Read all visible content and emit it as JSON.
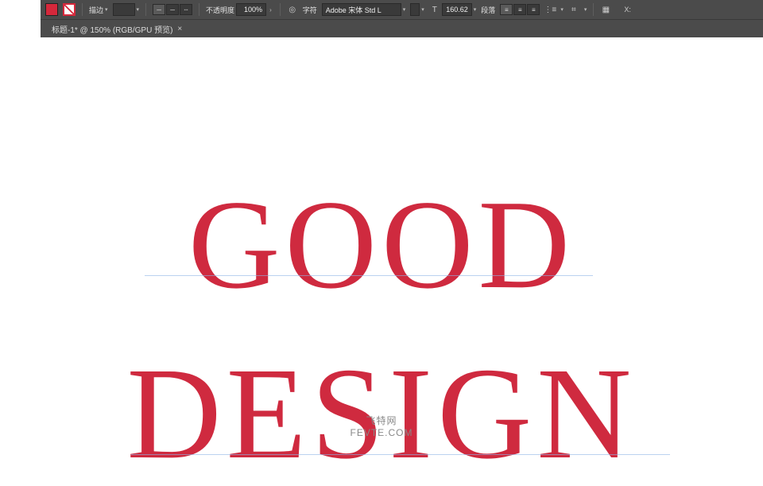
{
  "toolbar": {
    "brush_label": "描边",
    "thickness_dd": "",
    "opacity_label": "不透明度",
    "opacity_value": "100%",
    "char_label": "字符",
    "font_family": "Adobe 宋体 Std L",
    "font_size_value": "160.62",
    "paragraph_label": "段落"
  },
  "tab": {
    "label": "标题-1* @ 150% (RGB/GPU 预览)",
    "close": "×"
  },
  "canvas": {
    "line1": "GOOD",
    "line2": "DESIGN"
  },
  "watermark": {
    "l1": "飞特网",
    "l2": "FEVTE.COM"
  }
}
